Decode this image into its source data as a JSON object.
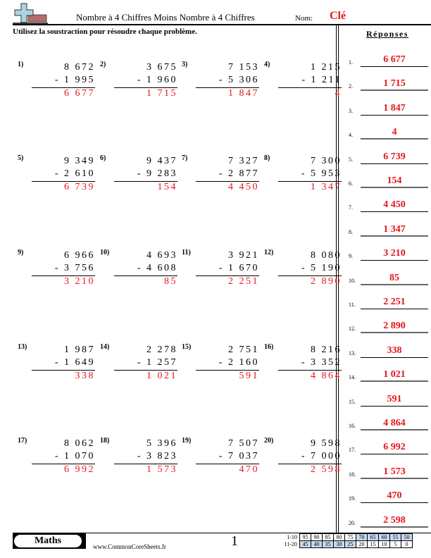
{
  "header": {
    "title": "Nombre à 4 Chiffres Moins Nombre à 4 Chiffres",
    "name_label": "Nom:",
    "name_value": "Clé",
    "instructions": "Utilisez la soustraction pour résoudre chaque problème.",
    "logo_icon": "plus-minus-logo-icon"
  },
  "answers_title": "Réponses",
  "problems": [
    {
      "num": "1)",
      "top": "8 672",
      "bottom": "- 1 995",
      "answer": "6 677"
    },
    {
      "num": "2)",
      "top": "3 675",
      "bottom": "- 1 960",
      "answer": "1 715"
    },
    {
      "num": "3)",
      "top": "7 153",
      "bottom": "- 5 306",
      "answer": "1 847"
    },
    {
      "num": "4)",
      "top": "1 215",
      "bottom": "- 1 211",
      "answer": "4"
    },
    {
      "num": "5)",
      "top": "9 349",
      "bottom": "- 2 610",
      "answer": "6 739"
    },
    {
      "num": "6)",
      "top": "9 437",
      "bottom": "- 9 283",
      "answer": "154"
    },
    {
      "num": "7)",
      "top": "7 327",
      "bottom": "- 2 877",
      "answer": "4 450"
    },
    {
      "num": "8)",
      "top": "7 300",
      "bottom": "- 5 953",
      "answer": "1 347"
    },
    {
      "num": "9)",
      "top": "6 966",
      "bottom": "- 3 756",
      "answer": "3 210"
    },
    {
      "num": "10)",
      "top": "4 693",
      "bottom": "- 4 608",
      "answer": "85"
    },
    {
      "num": "11)",
      "top": "3 921",
      "bottom": "- 1 670",
      "answer": "2 251"
    },
    {
      "num": "12)",
      "top": "8 080",
      "bottom": "- 5 190",
      "answer": "2 890"
    },
    {
      "num": "13)",
      "top": "1 987",
      "bottom": "- 1 649",
      "answer": "338"
    },
    {
      "num": "14)",
      "top": "2 278",
      "bottom": "- 1 257",
      "answer": "1 021"
    },
    {
      "num": "15)",
      "top": "2 751",
      "bottom": "- 2 160",
      "answer": "591"
    },
    {
      "num": "16)",
      "top": "8 216",
      "bottom": "- 3 352",
      "answer": "4 864"
    },
    {
      "num": "17)",
      "top": "8 062",
      "bottom": "- 1 070",
      "answer": "6 992"
    },
    {
      "num": "18)",
      "top": "5 396",
      "bottom": "- 3 823",
      "answer": "1 573"
    },
    {
      "num": "19)",
      "top": "7 507",
      "bottom": "- 7 037",
      "answer": "470"
    },
    {
      "num": "20)",
      "top": "9 598",
      "bottom": "- 7 000",
      "answer": "2 598"
    }
  ],
  "answer_key": [
    {
      "num": "1.",
      "value": "6 677"
    },
    {
      "num": "2.",
      "value": "1 715"
    },
    {
      "num": "3.",
      "value": "1 847"
    },
    {
      "num": "4.",
      "value": "4"
    },
    {
      "num": "5.",
      "value": "6 739"
    },
    {
      "num": "6.",
      "value": "154"
    },
    {
      "num": "7.",
      "value": "4 450"
    },
    {
      "num": "8.",
      "value": "1 347"
    },
    {
      "num": "9.",
      "value": "3 210"
    },
    {
      "num": "10.",
      "value": "85"
    },
    {
      "num": "11.",
      "value": "2 251"
    },
    {
      "num": "12.",
      "value": "2 890"
    },
    {
      "num": "13.",
      "value": "338"
    },
    {
      "num": "14.",
      "value": "1 021"
    },
    {
      "num": "15.",
      "value": "591"
    },
    {
      "num": "16.",
      "value": "4 864"
    },
    {
      "num": "17.",
      "value": "6 992"
    },
    {
      "num": "18.",
      "value": "1 573"
    },
    {
      "num": "19.",
      "value": "470"
    },
    {
      "num": "20.",
      "value": "2 598"
    }
  ],
  "footer": {
    "subject": "Maths",
    "site": "www.CommonCoreSheets.fr",
    "page": "1",
    "score_rows": [
      {
        "label": "1-10",
        "cells": [
          "95",
          "90",
          "85",
          "80",
          "75",
          "70",
          "65",
          "60",
          "55",
          "50"
        ],
        "highlight": [
          false,
          false,
          false,
          false,
          false,
          true,
          true,
          true,
          true,
          true
        ]
      },
      {
        "label": "11-20",
        "cells": [
          "45",
          "40",
          "35",
          "30",
          "25",
          "20",
          "15",
          "10",
          "5",
          "0"
        ],
        "highlight": [
          true,
          true,
          true,
          true,
          true,
          false,
          false,
          false,
          false,
          false
        ]
      }
    ]
  },
  "colors": {
    "answer_red": "#e8141c",
    "score_highlight": "#c6d9f1"
  }
}
